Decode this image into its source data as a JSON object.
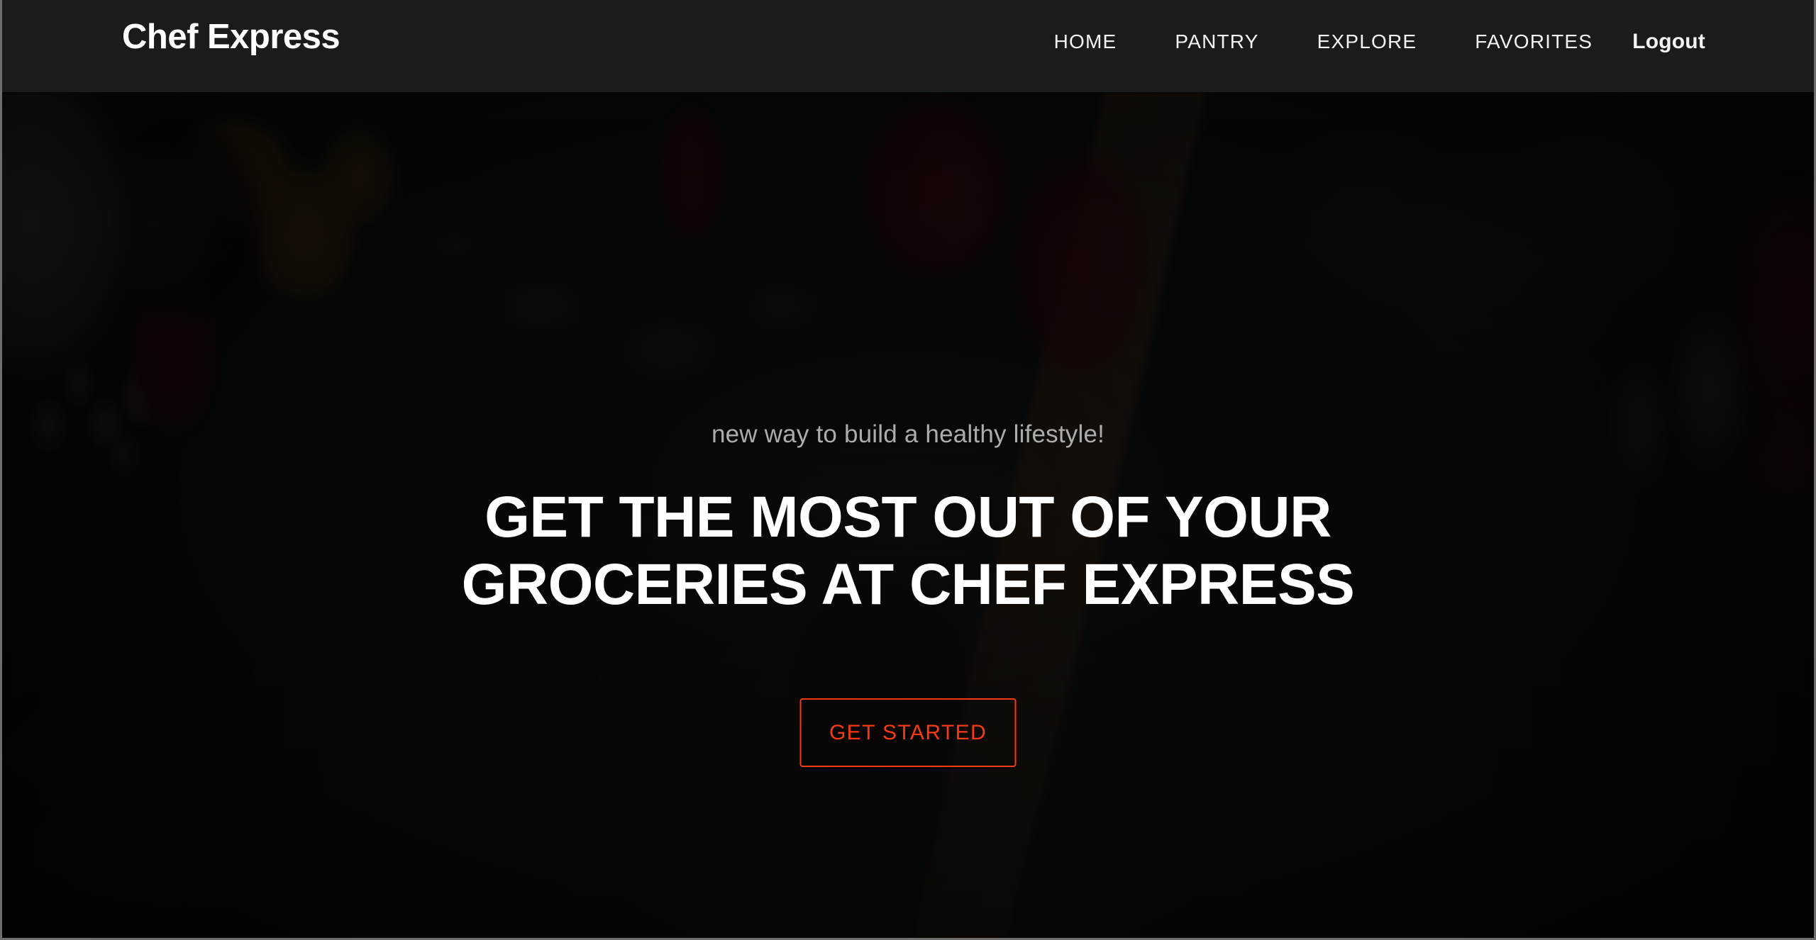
{
  "brand": {
    "name": "Chef Express"
  },
  "nav": {
    "items": [
      {
        "label": "HOME",
        "name": "nav-link-home"
      },
      {
        "label": "PANTRY",
        "name": "nav-link-pantry"
      },
      {
        "label": "EXPLORE",
        "name": "nav-link-explore"
      },
      {
        "label": "FAVORITES",
        "name": "nav-link-favorites"
      }
    ],
    "auth": {
      "label": "Logout"
    }
  },
  "hero": {
    "subtitle": "new way to build a healthy lifestyle!",
    "title_line1": "GET THE MOST OUT OF YOUR",
    "title_line2": "GROCERIES AT CHEF EXPRESS",
    "cta_label": "GET STARTED"
  },
  "colors": {
    "navbar_background": "#1a1b1d",
    "brand_text": "#ffffff",
    "nav_text": "#f2f2f2",
    "hero_subtitle": "#acacac",
    "hero_title": "#ffffff",
    "cta_accent": "#f63a13",
    "hero_base": "#3c4247"
  }
}
